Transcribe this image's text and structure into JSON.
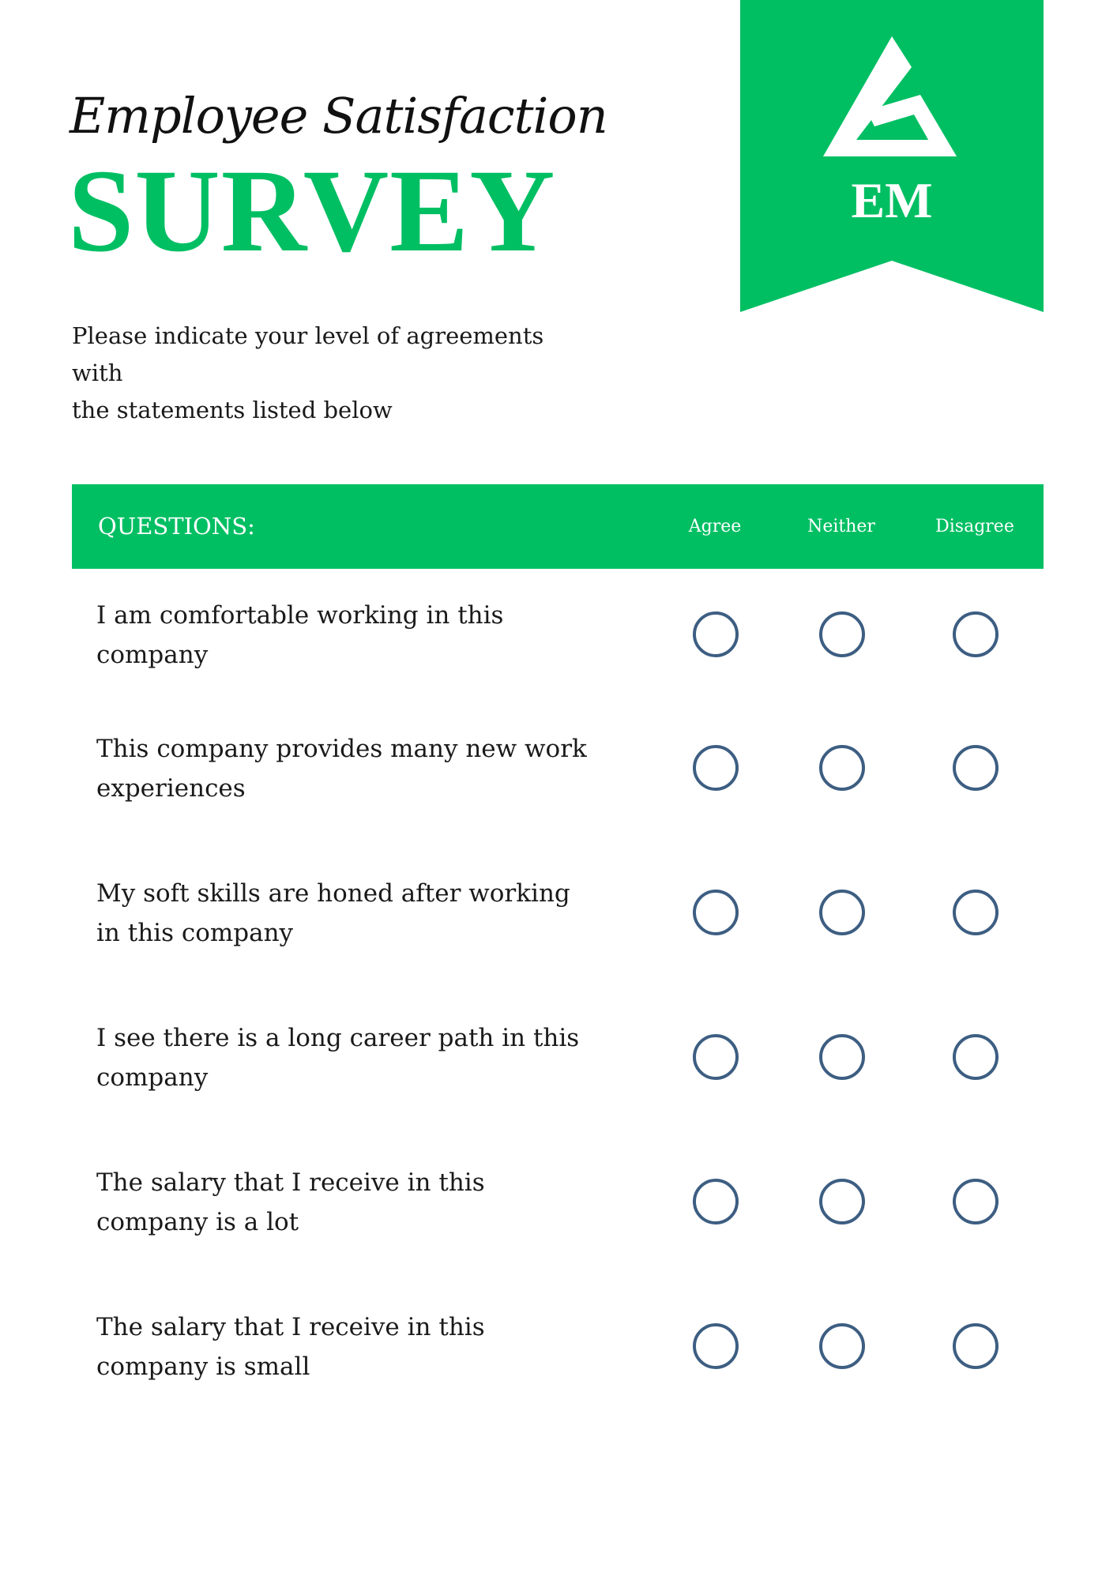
{
  "header": {
    "script_title": "Employee Satisfaction",
    "title": "SURVEY",
    "intro_line1": "Please indicate your level of agreements with",
    "intro_line2": "the statements listed below"
  },
  "logo": {
    "text": "EM",
    "icon": "triangle-logo-icon",
    "color": "#00bf63"
  },
  "table": {
    "header": {
      "questions": "QUESTIONS:",
      "columns": [
        "Agree",
        "Neither",
        "Disagree"
      ]
    },
    "rows": [
      {
        "line1": "I am comfortable working in this",
        "line2": "company"
      },
      {
        "line1": "This company provides many new work",
        "line2": "experiences"
      },
      {
        "line1": "My soft skills are honed after working",
        "line2": "in this company"
      },
      {
        "line1": "I see there is a long career path in this",
        "line2": "company"
      },
      {
        "line1": "The salary that I receive in this",
        "line2": "company is a lot"
      },
      {
        "line1": "The salary that I receive in this",
        "line2": "company is small"
      }
    ]
  },
  "colors": {
    "accent": "#00bf63",
    "radio_border": "#3d5e82",
    "text": "#1a1a1a"
  }
}
